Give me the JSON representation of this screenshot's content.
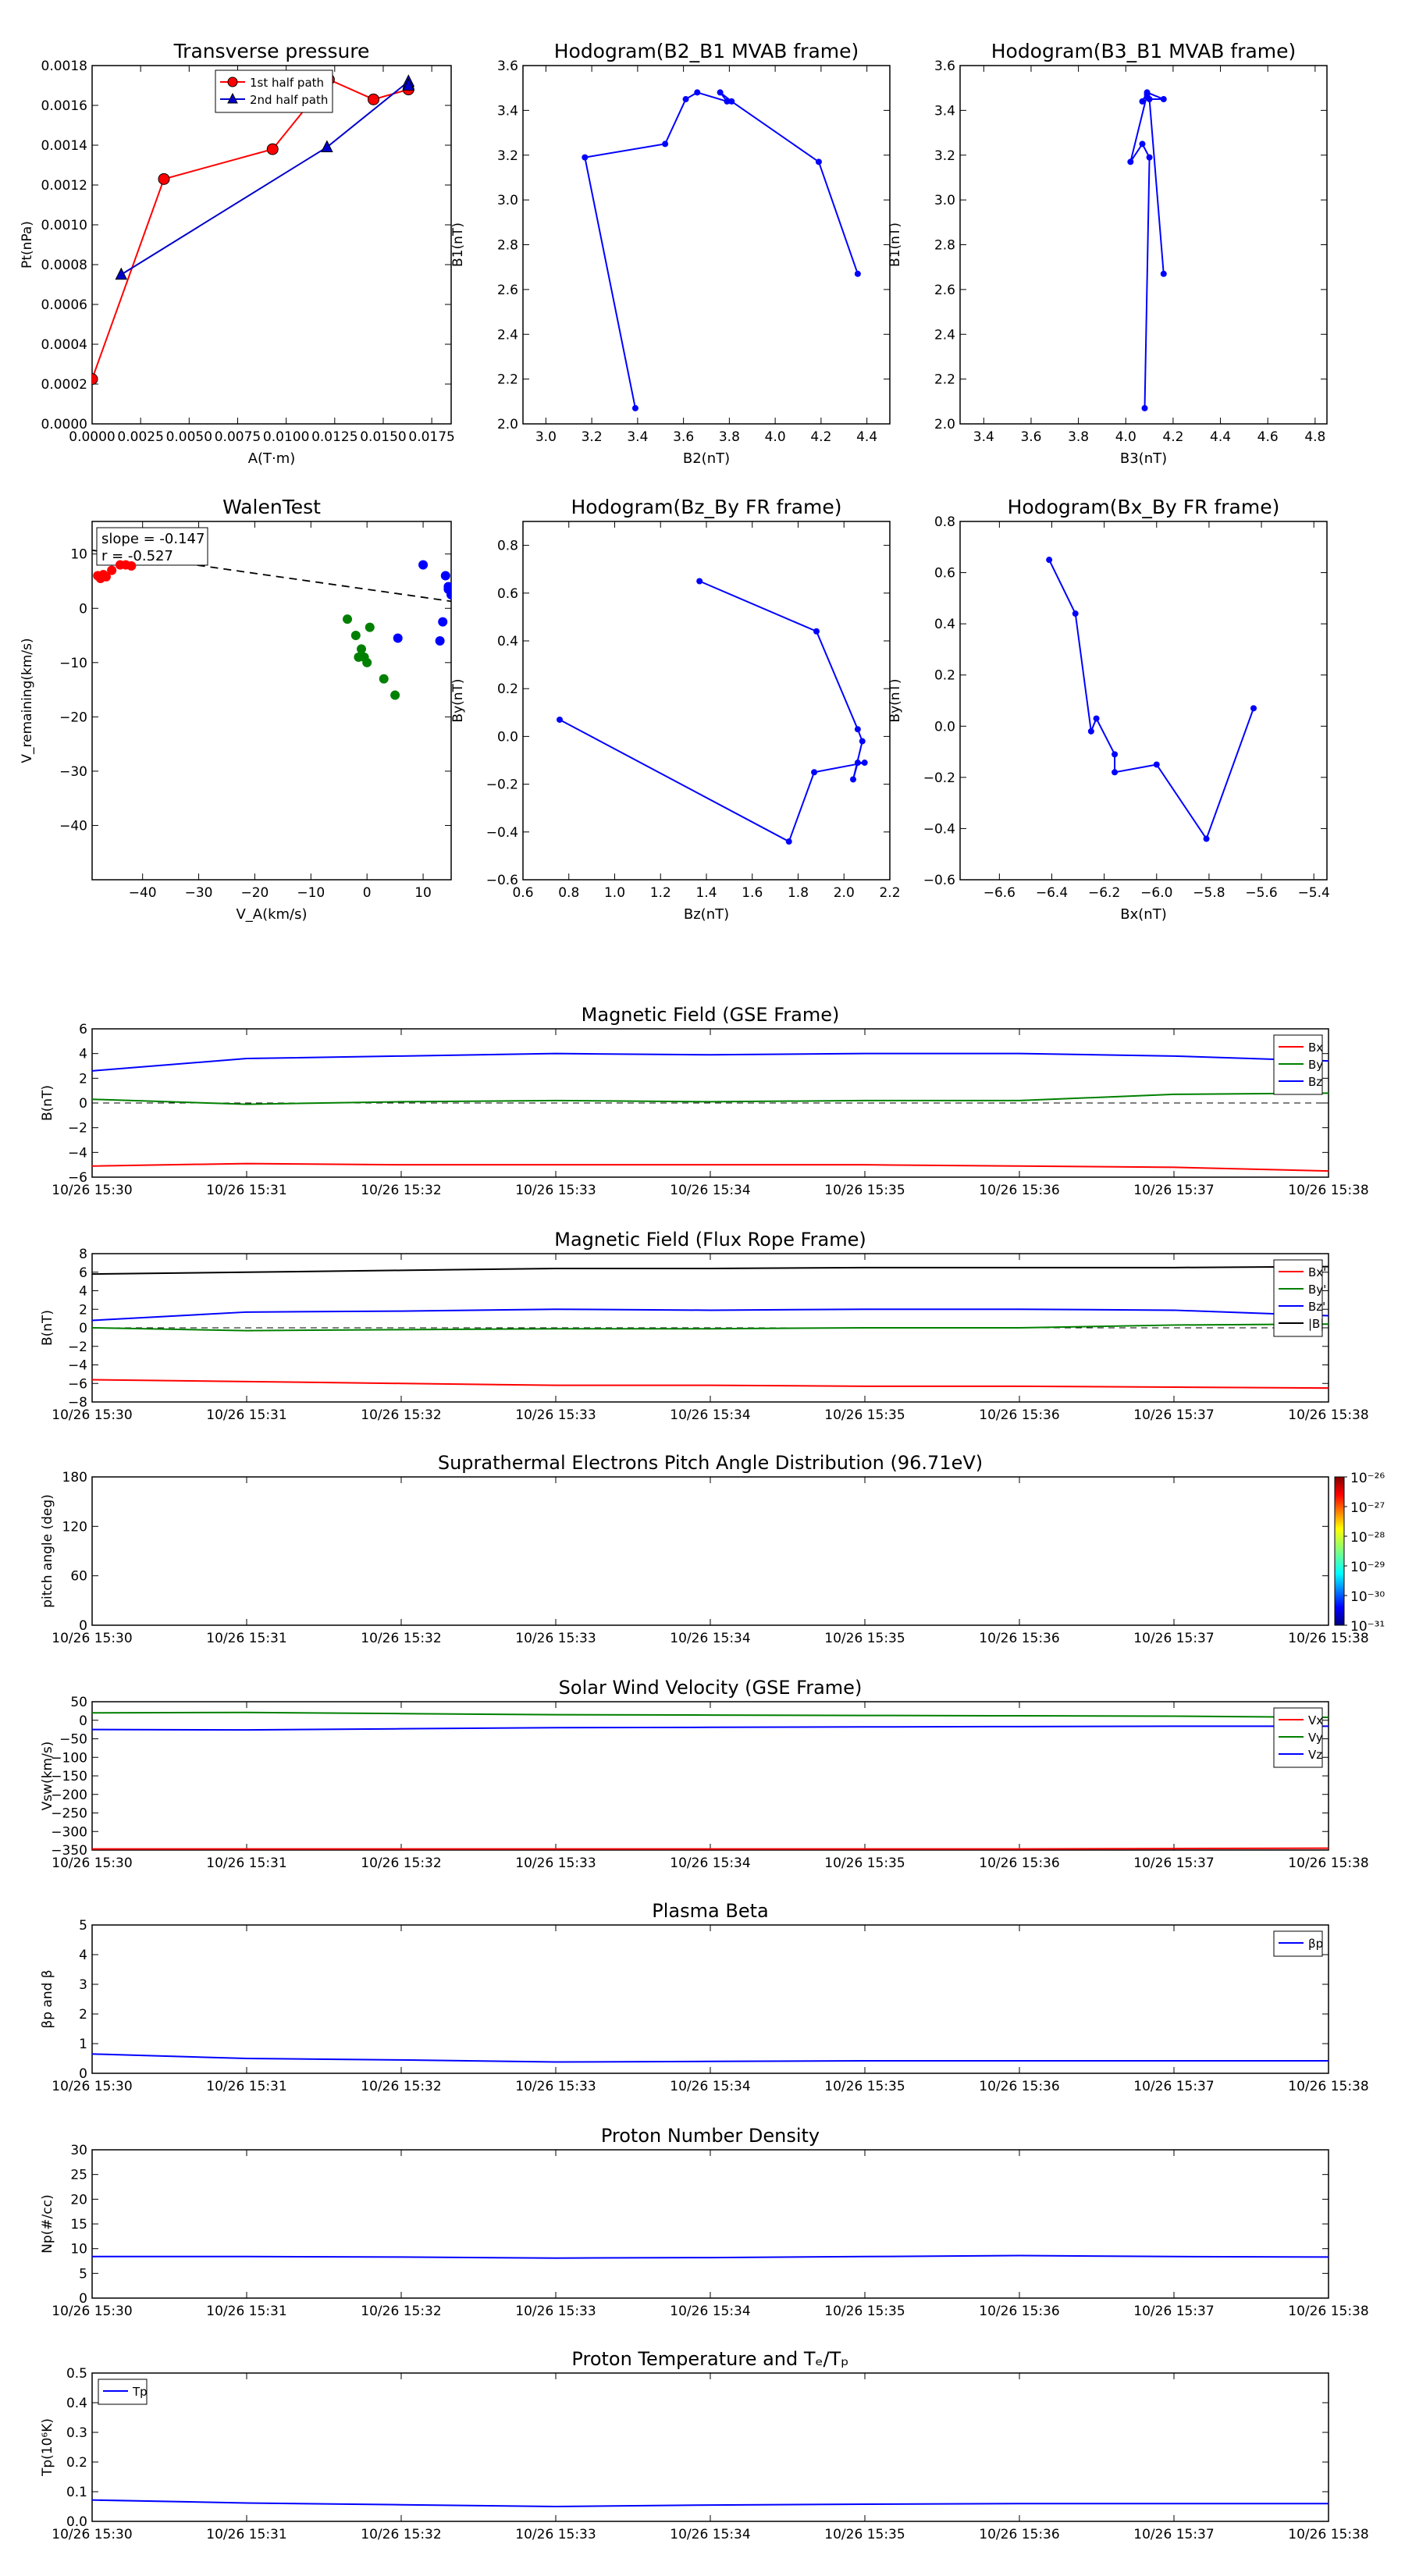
{
  "chart_data": [
    {
      "id": "tp",
      "type": "line",
      "title": "Transverse pressure",
      "xlabel": "A(T·m)",
      "ylabel": "Pt(nPa)",
      "xlim": [
        0,
        0.0185
      ],
      "ylim": [
        0,
        0.0018
      ],
      "xticks": [
        0,
        0.0025,
        0.005,
        0.0075,
        0.01,
        0.0125,
        0.015,
        0.0175
      ],
      "xticklabels": [
        "0.0000",
        "0.0025",
        "0.0050",
        "0.0075",
        "0.0100",
        "0.0125",
        "0.0150",
        "0.0175"
      ],
      "yticks": [
        0,
        0.0002,
        0.0004,
        0.0006,
        0.0008,
        0.001,
        0.0012,
        0.0014,
        0.0016,
        0.0018
      ],
      "yticklabels": [
        "0.0000",
        "0.0002",
        "0.0004",
        "0.0006",
        "0.0008",
        "0.0010",
        "0.0012",
        "0.0014",
        "0.0016",
        "0.0018"
      ],
      "legend": "top-center",
      "series": [
        {
          "name": "1st half path",
          "color": "#ff0000",
          "marker": "circle",
          "x": [
            0.0,
            0.0037,
            0.0093,
            0.0122,
            0.0145,
            0.0163
          ],
          "y": [
            0.000225,
            0.00123,
            0.00138,
            0.00173,
            0.00163,
            0.00168
          ]
        },
        {
          "name": "2nd half path",
          "color": "#0000cc",
          "marker": "triangle",
          "x": [
            0.0015,
            0.0121,
            0.0163,
            0.0163
          ],
          "y": [
            0.00075,
            0.00139,
            0.00172,
            0.0017
          ]
        }
      ]
    },
    {
      "id": "h21",
      "type": "line",
      "title": "Hodogram(B2_B1 MVAB frame)",
      "xlabel": "B2(nT)",
      "ylabel": "B1(nT)",
      "xlim": [
        2.9,
        4.5
      ],
      "ylim": [
        2.0,
        3.6
      ],
      "xticks": [
        3.0,
        3.2,
        3.4,
        3.6,
        3.8,
        4.0,
        4.2,
        4.4
      ],
      "xticklabels": [
        "3.0",
        "3.2",
        "3.4",
        "3.6",
        "3.8",
        "4.0",
        "4.2",
        "4.4"
      ],
      "yticks": [
        2.0,
        2.2,
        2.4,
        2.6,
        2.8,
        3.0,
        3.2,
        3.4,
        3.6
      ],
      "yticklabels": [
        "2.0",
        "2.2",
        "2.4",
        "2.6",
        "2.8",
        "3.0",
        "3.2",
        "3.4",
        "3.6"
      ],
      "series": [
        {
          "name": "",
          "color": "#0000ff",
          "marker": "dot",
          "x": [
            3.39,
            3.17,
            3.52,
            3.61,
            3.66,
            3.79,
            3.76,
            3.81,
            4.19,
            4.36
          ],
          "y": [
            2.07,
            3.19,
            3.25,
            3.45,
            3.48,
            3.44,
            3.48,
            3.44,
            3.17,
            2.67
          ]
        }
      ]
    },
    {
      "id": "h31",
      "type": "line",
      "title": "Hodogram(B3_B1 MVAB frame)",
      "xlabel": "B3(nT)",
      "ylabel": "B1(nT)",
      "xlim": [
        3.3,
        4.85
      ],
      "ylim": [
        2.0,
        3.6
      ],
      "xticks": [
        3.4,
        3.6,
        3.8,
        4.0,
        4.2,
        4.4,
        4.6,
        4.8
      ],
      "xticklabels": [
        "3.4",
        "3.6",
        "3.8",
        "4.0",
        "4.2",
        "4.4",
        "4.6",
        "4.8"
      ],
      "yticks": [
        2.0,
        2.2,
        2.4,
        2.6,
        2.8,
        3.0,
        3.2,
        3.4,
        3.6
      ],
      "yticklabels": [
        "2.0",
        "2.2",
        "2.4",
        "2.6",
        "2.8",
        "3.0",
        "3.2",
        "3.4",
        "3.6"
      ],
      "series": [
        {
          "name": "",
          "color": "#0000ff",
          "marker": "dot",
          "x": [
            4.08,
            4.1,
            4.07,
            4.02,
            4.09,
            4.07,
            4.09,
            4.16,
            4.1,
            4.16
          ],
          "y": [
            2.07,
            3.19,
            3.25,
            3.17,
            3.47,
            3.44,
            3.48,
            3.45,
            3.45,
            2.67
          ]
        }
      ]
    },
    {
      "id": "walen",
      "type": "scatter",
      "title": "WalenTest",
      "xlabel": "V_A(km/s)",
      "ylabel": "V_remaining(km/s)",
      "xlim": [
        -49,
        15
      ],
      "ylim": [
        -50,
        16
      ],
      "xticks": [
        -40,
        -30,
        -20,
        -10,
        0,
        10
      ],
      "xticklabels": [
        "−40",
        "−30",
        "−20",
        "−10",
        "0",
        "10"
      ],
      "yticks": [
        10,
        0,
        -10,
        -20,
        -30,
        -40
      ],
      "yticklabels": [
        "10",
        "0",
        "−10",
        "−20",
        "−30",
        "−40"
      ],
      "annotations": [
        "slope = -0.147",
        "r = -0.527"
      ],
      "fit": {
        "slope": -0.147,
        "intercept": 3.5
      },
      "series": [
        {
          "name": "",
          "color": "#ff0000",
          "x": [
            -48,
            -47.5,
            -47,
            -46.5,
            -45.5,
            -44,
            -43,
            -42
          ],
          "y": [
            6,
            5.5,
            6.2,
            5.8,
            7,
            8,
            8,
            7.8
          ]
        },
        {
          "name": "",
          "color": "#008000",
          "x": [
            -3.5,
            -2,
            -1.5,
            -1,
            -0.5,
            0,
            0.5,
            3,
            5
          ],
          "y": [
            -2,
            -5,
            -9,
            -7.5,
            -9,
            -10,
            -3.5,
            -13,
            -16
          ]
        },
        {
          "name": "",
          "color": "#0000ff",
          "x": [
            5.5,
            10,
            13,
            13.5,
            14,
            14.5,
            14.5,
            15,
            15
          ],
          "y": [
            -5.5,
            8,
            -6,
            -2.5,
            6,
            4,
            3.5,
            2.5,
            3
          ]
        }
      ]
    },
    {
      "id": "hzy",
      "type": "line",
      "title": "Hodogram(Bz_By FR frame)",
      "xlabel": "Bz(nT)",
      "ylabel": "By(nT)",
      "xlim": [
        0.6,
        2.2
      ],
      "ylim": [
        -0.6,
        0.9
      ],
      "xticks": [
        0.6,
        0.8,
        1.0,
        1.2,
        1.4,
        1.6,
        1.8,
        2.0,
        2.2
      ],
      "xticklabels": [
        "0.6",
        "0.8",
        "1.0",
        "1.2",
        "1.4",
        "1.6",
        "1.8",
        "2.0",
        "2.2"
      ],
      "yticks": [
        -0.6,
        -0.4,
        -0.2,
        0.0,
        0.2,
        0.4,
        0.6,
        0.8
      ],
      "yticklabels": [
        "−0.6",
        "−0.4",
        "−0.2",
        "0.0",
        "0.2",
        "0.4",
        "0.6",
        "0.8"
      ],
      "series": [
        {
          "name": "",
          "color": "#0000ff",
          "marker": "dot",
          "x": [
            1.37,
            1.88,
            2.06,
            2.08,
            2.04,
            2.06,
            2.09,
            1.87,
            1.76,
            0.76
          ],
          "y": [
            0.65,
            0.44,
            0.03,
            -0.02,
            -0.18,
            -0.11,
            -0.11,
            -0.15,
            -0.44,
            0.07
          ]
        }
      ]
    },
    {
      "id": "hxy",
      "type": "line",
      "title": "Hodogram(Bx_By FR frame)",
      "xlabel": "Bx(nT)",
      "ylabel": "By(nT)",
      "xlim": [
        -6.75,
        -5.35
      ],
      "ylim": [
        -0.6,
        0.8
      ],
      "xticks": [
        -6.6,
        -6.4,
        -6.2,
        -6.0,
        -5.8,
        -5.6,
        -5.4
      ],
      "xticklabels": [
        "−6.6",
        "−6.4",
        "−6.2",
        "−6.0",
        "−5.8",
        "−5.6",
        "−5.4"
      ],
      "yticks": [
        -0.6,
        -0.4,
        -0.2,
        0.0,
        0.2,
        0.4,
        0.6,
        0.8
      ],
      "yticklabels": [
        "−0.6",
        "−0.4",
        "−0.2",
        "0.0",
        "0.2",
        "0.4",
        "0.6",
        "0.8"
      ],
      "series": [
        {
          "name": "",
          "color": "#0000ff",
          "marker": "dot",
          "x": [
            -6.41,
            -6.31,
            -6.25,
            -6.23,
            -6.16,
            -6.16,
            -6.0,
            -5.81,
            -5.63
          ],
          "y": [
            0.65,
            0.44,
            -0.02,
            0.03,
            -0.11,
            -0.18,
            -0.15,
            -0.44,
            0.07
          ]
        }
      ]
    },
    {
      "id": "bgse",
      "type": "line",
      "title": "Magnetic Field (GSE Frame)",
      "ylabel": "B(nT)",
      "xlim": [
        0,
        8
      ],
      "ylim": [
        -6,
        6
      ],
      "yticks": [
        6,
        4,
        2,
        0,
        -2,
        -4,
        -6
      ],
      "yticklabels": [
        "6",
        "4",
        "2",
        "0",
        "−2",
        "−4",
        "−6"
      ],
      "zero_line": true,
      "legend": "top-right",
      "series": [
        {
          "name": "Bx",
          "color": "#ff0000",
          "x": [
            0,
            1,
            2,
            3,
            4,
            5,
            6,
            7,
            8
          ],
          "y": [
            -5.1,
            -4.9,
            -5.0,
            -5.0,
            -5.0,
            -5.0,
            -5.1,
            -5.2,
            -5.5
          ]
        },
        {
          "name": "By",
          "color": "#008000",
          "x": [
            0,
            1,
            2,
            3,
            4,
            5,
            6,
            7,
            8
          ],
          "y": [
            0.3,
            -0.1,
            0.1,
            0.2,
            0.1,
            0.2,
            0.2,
            0.7,
            0.8
          ]
        },
        {
          "name": "Bz",
          "color": "#0000ff",
          "x": [
            0,
            1,
            2,
            3,
            4,
            5,
            6,
            7,
            8
          ],
          "y": [
            2.6,
            3.6,
            3.8,
            4.0,
            3.9,
            4.0,
            4.0,
            3.8,
            3.4
          ]
        }
      ]
    },
    {
      "id": "bfr",
      "type": "line",
      "title": "Magnetic Field (Flux Rope Frame)",
      "ylabel": "B(nT)",
      "xlim": [
        0,
        8
      ],
      "ylim": [
        -8,
        8
      ],
      "yticks": [
        8,
        6,
        4,
        2,
        0,
        -2,
        -4,
        -6,
        -8
      ],
      "yticklabels": [
        "8",
        "6",
        "4",
        "2",
        "0",
        "−2",
        "−4",
        "−6",
        "−8"
      ],
      "zero_line": true,
      "legend": "top-right",
      "series": [
        {
          "name": "Bx'",
          "color": "#ff0000",
          "x": [
            0,
            1,
            2,
            3,
            4,
            5,
            6,
            7,
            8
          ],
          "y": [
            -5.6,
            -5.8,
            -6.0,
            -6.2,
            -6.2,
            -6.3,
            -6.3,
            -6.4,
            -6.5
          ]
        },
        {
          "name": "By'",
          "color": "#008000",
          "x": [
            0,
            1,
            2,
            3,
            4,
            5,
            6,
            7,
            8
          ],
          "y": [
            0.0,
            -0.3,
            -0.2,
            -0.1,
            -0.1,
            0.0,
            0.0,
            0.3,
            0.4
          ]
        },
        {
          "name": "Bz'",
          "color": "#0000ff",
          "x": [
            0,
            1,
            2,
            3,
            4,
            5,
            6,
            7,
            8
          ],
          "y": [
            0.8,
            1.7,
            1.8,
            2.0,
            1.9,
            2.0,
            2.0,
            1.9,
            1.3
          ]
        },
        {
          "name": "|B|",
          "color": "#000000",
          "x": [
            0,
            1,
            2,
            3,
            4,
            5,
            6,
            7,
            8
          ],
          "y": [
            5.8,
            6.0,
            6.2,
            6.4,
            6.4,
            6.5,
            6.5,
            6.5,
            6.6
          ]
        }
      ]
    },
    {
      "id": "pad",
      "type": "heatmap",
      "title": "Suprathermal Electrons Pitch Angle Distribution (96.71eV)",
      "ylabel": "pitch angle (deg)",
      "xlim": [
        0,
        8
      ],
      "ylim": [
        0,
        180
      ],
      "yticks": [
        180,
        120,
        60,
        0
      ],
      "yticklabels": [
        "180",
        "120",
        "60",
        "0"
      ],
      "colorbar_ticks": [
        "10⁻²⁶",
        "10⁻²⁷",
        "10⁻²⁸",
        "10⁻²⁹",
        "10⁻³⁰",
        "10⁻³¹"
      ]
    },
    {
      "id": "vsw",
      "type": "line",
      "title": "Solar Wind Velocity (GSE Frame)",
      "ylabel": "Vsw(km/s)",
      "xlim": [
        0,
        8
      ],
      "ylim": [
        -350,
        50
      ],
      "yticks": [
        50,
        0,
        -50,
        -100,
        -150,
        -200,
        -250,
        -300,
        -350
      ],
      "yticklabels": [
        "50",
        "0",
        "−50",
        "−100",
        "−150",
        "−200",
        "−250",
        "−300",
        "−350"
      ],
      "legend": "top-right",
      "series": [
        {
          "name": "Vx",
          "color": "#ff0000",
          "x": [
            0,
            1,
            2,
            3,
            4,
            5,
            6,
            7,
            8
          ],
          "y": [
            -347,
            -347,
            -347,
            -347,
            -347,
            -347,
            -347,
            -346,
            -345
          ]
        },
        {
          "name": "Vy",
          "color": "#008000",
          "x": [
            0,
            1,
            2,
            3,
            4,
            5,
            6,
            7,
            8
          ],
          "y": [
            20,
            21,
            18,
            15,
            14,
            13,
            12,
            11,
            8
          ]
        },
        {
          "name": "Vz",
          "color": "#0000ff",
          "x": [
            0,
            1,
            2,
            3,
            4,
            5,
            6,
            7,
            8
          ],
          "y": [
            -25,
            -26,
            -23,
            -20,
            -19,
            -18,
            -17,
            -16,
            -16
          ]
        }
      ]
    },
    {
      "id": "beta",
      "type": "line",
      "title": "Plasma Beta",
      "ylabel": "βp and β",
      "xlim": [
        0,
        8
      ],
      "ylim": [
        0,
        5
      ],
      "yticks": [
        5,
        4,
        3,
        2,
        1,
        0
      ],
      "yticklabels": [
        "5",
        "4",
        "3",
        "2",
        "1",
        "0"
      ],
      "legend": "top-right",
      "series": [
        {
          "name": "βp",
          "color": "#0000ff",
          "x": [
            0,
            1,
            2,
            3,
            4,
            5,
            6,
            7,
            8
          ],
          "y": [
            0.65,
            0.5,
            0.45,
            0.38,
            0.4,
            0.42,
            0.42,
            0.42,
            0.42
          ]
        }
      ]
    },
    {
      "id": "np",
      "type": "line",
      "title": "Proton Number Density",
      "ylabel": "Np(#/cc)",
      "xlim": [
        0,
        8
      ],
      "ylim": [
        0,
        30
      ],
      "yticks": [
        30,
        25,
        20,
        15,
        10,
        5,
        0
      ],
      "yticklabels": [
        "30",
        "25",
        "20",
        "15",
        "10",
        "5",
        "0"
      ],
      "series": [
        {
          "name": "",
          "color": "#0000ff",
          "x": [
            0,
            1,
            2,
            3,
            4,
            5,
            6,
            7,
            8
          ],
          "y": [
            8.4,
            8.4,
            8.3,
            8.1,
            8.2,
            8.4,
            8.6,
            8.4,
            8.3
          ]
        }
      ]
    },
    {
      "id": "tp2",
      "type": "line",
      "title": "Proton Temperature and Tₑ/Tₚ",
      "ylabel": "Tp(10⁶K)",
      "xlim": [
        0,
        8
      ],
      "ylim": [
        0,
        0.5
      ],
      "yticks": [
        0.5,
        0.4,
        0.3,
        0.2,
        0.1,
        0.0
      ],
      "yticklabels": [
        "0.5",
        "0.4",
        "0.3",
        "0.2",
        "0.1",
        "0.0"
      ],
      "legend": "top-left",
      "series": [
        {
          "name": "Tp",
          "color": "#0000ff",
          "x": [
            0,
            1,
            2,
            3,
            4,
            5,
            6,
            7,
            8
          ],
          "y": [
            0.072,
            0.062,
            0.056,
            0.05,
            0.055,
            0.058,
            0.06,
            0.06,
            0.06
          ]
        }
      ]
    }
  ],
  "time_ticks": [
    "10/26 15:30",
    "10/26 15:31",
    "10/26 15:32",
    "10/26 15:33",
    "10/26 15:34",
    "10/26 15:35",
    "10/26 15:36",
    "10/26 15:37",
    "10/26 15:38"
  ]
}
